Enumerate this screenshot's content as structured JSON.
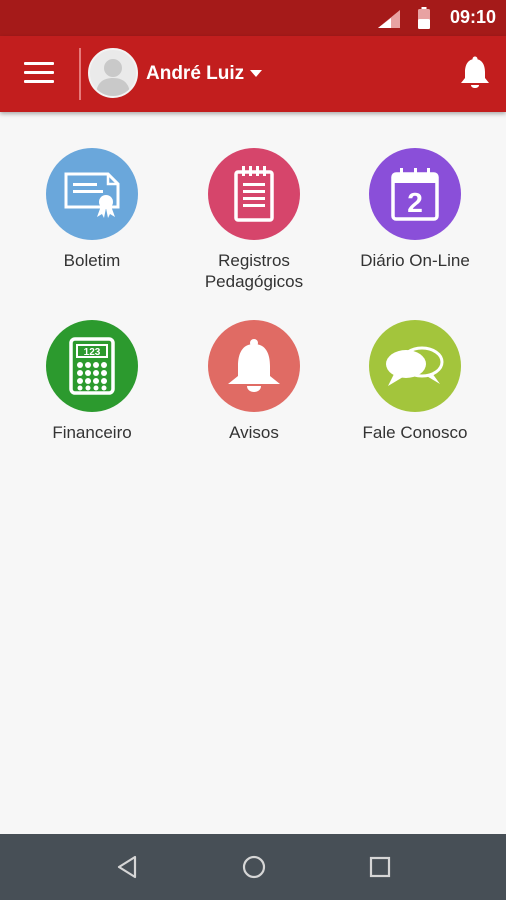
{
  "status_bar": {
    "time": "09:10",
    "signal_icon": "signal-icon",
    "battery_icon": "battery-icon"
  },
  "app_bar": {
    "user_name": "André Luiz",
    "menu_icon": "hamburger-menu-icon",
    "dropdown_icon": "caret-down-icon",
    "notifications_icon": "bell-icon"
  },
  "menu_items": [
    {
      "label": "Boletim",
      "icon": "certificate-icon",
      "color": "#6aa7db"
    },
    {
      "label": "Registros\nPedagógicos",
      "icon": "notepad-icon",
      "color": "#d6456b"
    },
    {
      "label": "Diário On-Line",
      "icon": "calendar-icon",
      "color": "#8a4fd9"
    },
    {
      "label": "Financeiro",
      "icon": "calculator-icon",
      "color": "#2c9a2e"
    },
    {
      "label": "Avisos",
      "icon": "bell-icon",
      "color": "#e06b64"
    },
    {
      "label": "Fale Conosco",
      "icon": "chat-bubbles-icon",
      "color": "#a3c53c"
    }
  ],
  "calendar_day": "2",
  "calculator_display": "123",
  "nav_bar": {
    "back_icon": "back-icon",
    "home_icon": "home-icon",
    "recents_icon": "recents-icon"
  }
}
